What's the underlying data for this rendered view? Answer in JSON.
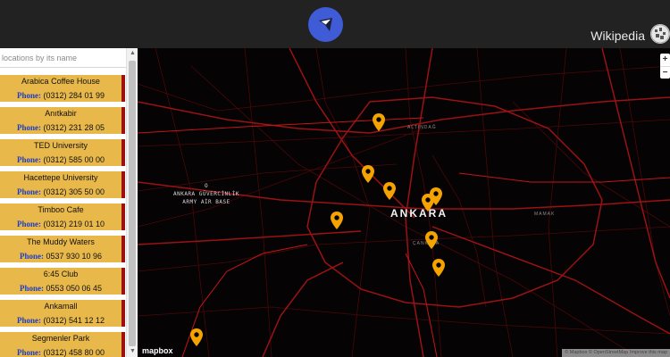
{
  "header": {
    "logo_icon": "compass-location-icon",
    "wiki_label": "Wikipedia",
    "wiki_icon": "wikipedia-globe-icon",
    "logo_color": "#3f5bd6"
  },
  "sidebar": {
    "search_placeholder": "locations by its name",
    "phone_label": "Phone:",
    "items": [
      {
        "name": "Arabica Coffee House",
        "phone": "(0312) 284 01 99"
      },
      {
        "name": "Anıtkabir",
        "phone": "(0312) 231 28 05"
      },
      {
        "name": "TED University",
        "phone": "(0312) 585 00 00"
      },
      {
        "name": "Hacettepe University",
        "phone": "(0312) 305 50 00"
      },
      {
        "name": "Timboo Cafe",
        "phone": "(0312) 219 01 10"
      },
      {
        "name": "The Muddy Waters",
        "phone": "0537 930 10 96"
      },
      {
        "name": "6:45 Club",
        "phone": "0553 050 06 45"
      },
      {
        "name": "Ankamall",
        "phone": "(0312) 541 12 12"
      },
      {
        "name": "Segmenler Park",
        "phone": "(0312) 458 80 00"
      }
    ],
    "card_color": "#e8b84a",
    "card_border_color": "#9e1010"
  },
  "map": {
    "city_label": "ANKARA",
    "base_label_mark": "O",
    "base_label_line1": "ANKARA GÜVERCİNLİK",
    "base_label_line2": "ARMY AİR BASE",
    "district_altindag": "ALTINDAĞ",
    "district_mamak": "MAMAK",
    "district_cankaya": "ÇANKAYA",
    "zoom_in": "+",
    "zoom_out": "−",
    "mapbox_logo": "mapbox",
    "attribution": "© Mapbox © OpenStreetMap Improve this map",
    "pin_color": "#f5a300",
    "road_color": "#7a0f10"
  }
}
